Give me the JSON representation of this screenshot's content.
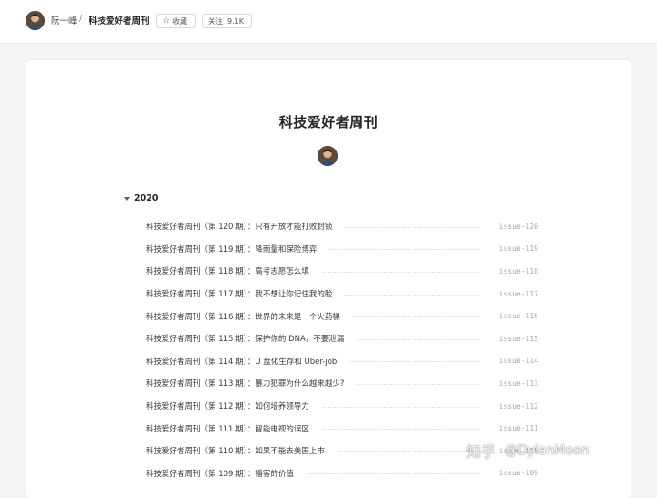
{
  "header": {
    "author_name": "阮一峰",
    "separator": "/",
    "page_name": "科技爱好者周刊",
    "collect_label": "收藏",
    "follow_label": "关注",
    "follow_count": "9.1K"
  },
  "main": {
    "title": "科技爱好者周刊",
    "year": "2020",
    "issues": [
      {
        "title": "科技爱好者周刊（第 120 期）：只有开放才能打败封锁",
        "slug": "issue-120"
      },
      {
        "title": "科技爱好者周刊（第 119 期）：降雨量和保险博弈",
        "slug": "issue-119"
      },
      {
        "title": "科技爱好者周刊（第 118 期）：高考志愿怎么填",
        "slug": "issue-118"
      },
      {
        "title": "科技爱好者周刊（第 117 期）：我不想让你记住我的脸",
        "slug": "issue-117"
      },
      {
        "title": "科技爱好者周刊（第 116 期）：世界的未来是一个火药桶",
        "slug": "issue-116"
      },
      {
        "title": "科技爱好者周刊（第 115 期）：保护你的 DNA，不要泄漏",
        "slug": "issue-115"
      },
      {
        "title": "科技爱好者周刊（第 114 期）：U 盘化生存和 Uber-job",
        "slug": "issue-114"
      },
      {
        "title": "科技爱好者周刊（第 113 期）：暴力犯罪为什么越来越少?",
        "slug": "issue-113"
      },
      {
        "title": "科技爱好者周刊（第 112 期）：如何培养领导力",
        "slug": "issue-112"
      },
      {
        "title": "科技爱好者周刊（第 111 期）：智能电视的误区",
        "slug": "issue-111"
      },
      {
        "title": "科技爱好者周刊（第 110 期）：如果不能去美国上市",
        "slug": "issue-110"
      },
      {
        "title": "科技爱好者周刊（第 109 期）：播客的价值",
        "slug": "issue-109"
      }
    ]
  },
  "watermark": {
    "brand": "知乎",
    "handle": "@DylanMoon"
  },
  "icons": {
    "collect": "star-outline-icon",
    "year_toggle": "caret-down-icon"
  }
}
